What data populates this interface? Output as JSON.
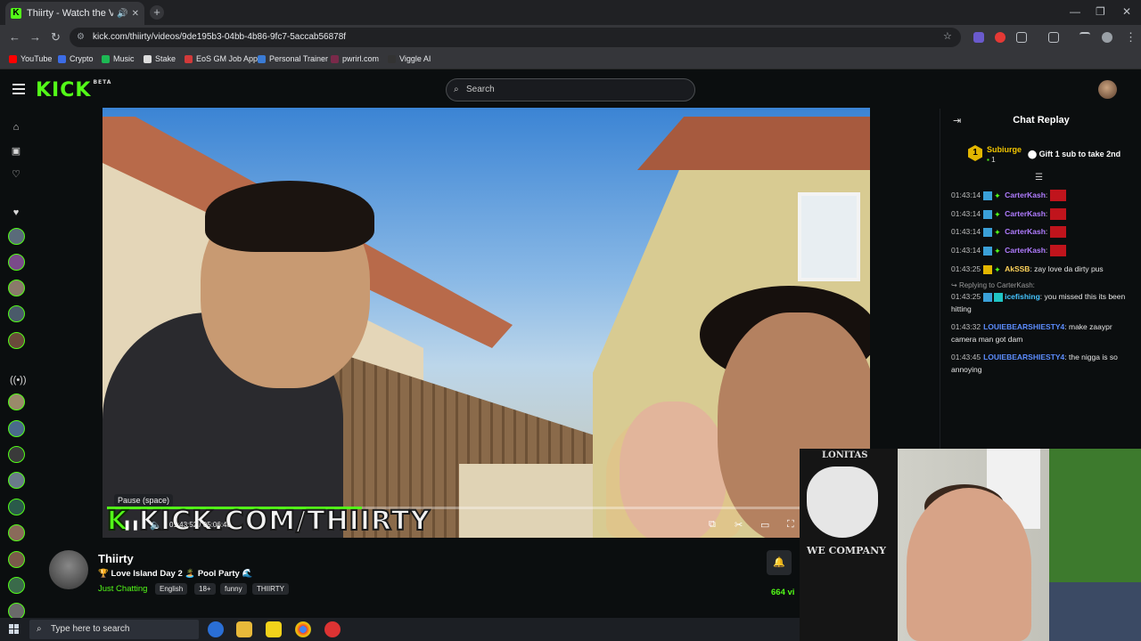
{
  "browser": {
    "tab_title": "Thiirty - Watch the VOD on",
    "url": "kick.com/thiirty/videos/9de195b3-04bb-4b86-9fc7-5accab56878f",
    "bookmarks": [
      {
        "label": "YouTube",
        "color": "#ff0000"
      },
      {
        "label": "Crypto",
        "color": "#3c6ce6"
      },
      {
        "label": "Music",
        "color": "#1db954"
      },
      {
        "label": "Stake",
        "color": "#dddddd"
      },
      {
        "label": "EoS GM Job App",
        "color": "#d23a3a"
      },
      {
        "label": "Personal Trainer",
        "color": "#3a7bd5"
      },
      {
        "label": "pwrirl.com",
        "color": "#7a2a4a"
      },
      {
        "label": "Viggle AI",
        "color": "#333333"
      }
    ]
  },
  "kick": {
    "logo": "KICK",
    "logo_badge": "BETA",
    "search_placeholder": "Search",
    "accent": "#53fc18"
  },
  "player": {
    "tooltip": "Pause (space)",
    "watermark_prefix": "K",
    "watermark_text": "KICK.COM/THIIRTY",
    "time": "01:43:52 / 05:06:48",
    "progress": 0.34
  },
  "chat": {
    "title": "Chat Replay",
    "sub_leader": {
      "rank": "1",
      "name": "Subiurge",
      "count": "1"
    },
    "gift_text": "Gift 1 sub to take 2nd",
    "messages": [
      {
        "time": "01:43:14",
        "user": "CarterKash",
        "text": "",
        "cls": "u-purple",
        "emote": true
      },
      {
        "time": "01:43:14",
        "user": "CarterKash",
        "text": "",
        "cls": "u-purple",
        "emote": true
      },
      {
        "time": "01:43:14",
        "user": "CarterKash",
        "text": "",
        "cls": "u-purple",
        "emote": true
      },
      {
        "time": "01:43:14",
        "user": "CarterKash",
        "text": "",
        "cls": "u-purple",
        "emote": true
      },
      {
        "time": "01:43:25",
        "user": "AkSSB",
        "text": "zay love da dirty pus",
        "cls": "u-yellow",
        "emote": false
      }
    ],
    "reply_label": "Replying to CarterKash:",
    "reply_msg": {
      "time": "01:43:25",
      "user": "icefishing",
      "text": "you missed this its been hitting"
    },
    "msg_louie1": {
      "time": "01:43:32",
      "user": "LOUIEBEARSHIESTY4",
      "text": "make zaaypr camera man got dam"
    },
    "msg_louie2": {
      "time": "01:43:45",
      "user": "LOUIEBEARSHIESTY4",
      "text": "the nigga is so annoying"
    }
  },
  "stream": {
    "name": "Thiirty",
    "title": "🏆 Love Island Day 2 🏝️ Pool Party 🌊",
    "category": "Just Chatting",
    "tags": [
      "English",
      "18+",
      "funny",
      "THIIRTY"
    ],
    "viewers": "664 vi"
  },
  "webcam": {
    "shirt_top": "LONITAS",
    "shirt_mid": "WE COMPANY"
  },
  "taskbar": {
    "search_placeholder": "Type here to search"
  }
}
